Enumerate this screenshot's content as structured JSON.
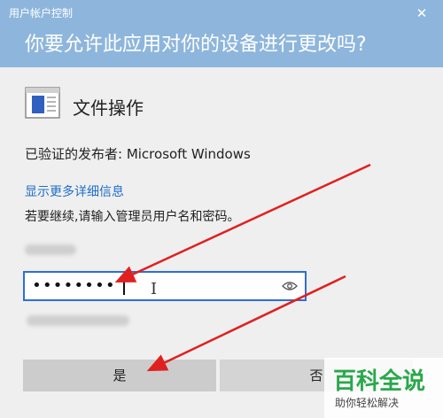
{
  "dialog": {
    "caption": "用户帐户控制",
    "question": "你要允许此应用对你的设备进行更改吗?",
    "close_label": "✕"
  },
  "app": {
    "name": "文件操作",
    "icon": "file-window-icon"
  },
  "publisher": "已验证的发布者: Microsoft Windows",
  "details_link": "显示更多详细信息",
  "instruction": "若要继续,请输入管理员用户名和密码。",
  "password_field": {
    "value": "••••••••",
    "reveal_icon": "eye-icon"
  },
  "buttons": {
    "yes": "是",
    "no": "否"
  },
  "watermark": {
    "title": "百科全说",
    "subtitle": "助你轻松解决"
  },
  "colors": {
    "header": "#8eb6dc",
    "link": "#1f6fc7",
    "field_border": "#2f6fcf",
    "annotation_arrow": "#e02020",
    "watermark_green": "#2aa84a"
  }
}
